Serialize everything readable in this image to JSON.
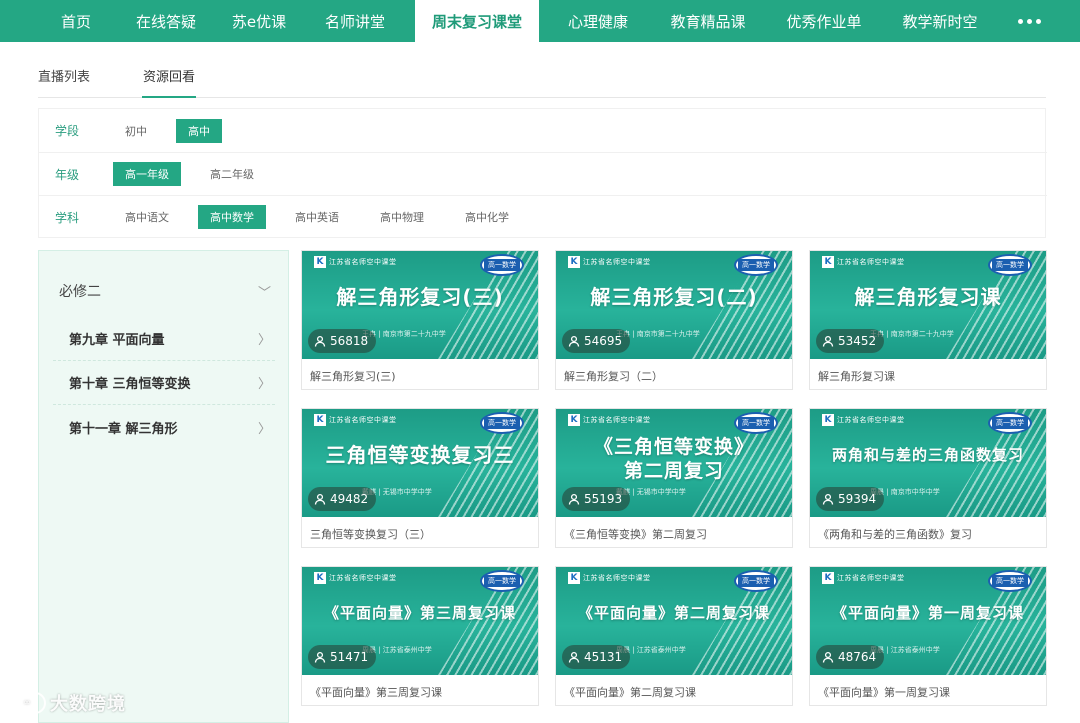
{
  "nav": {
    "items": [
      "首页",
      "在线答疑",
      "苏e优课",
      "名师讲堂",
      "周末复习课堂",
      "心理健康",
      "教育精品课",
      "优秀作业单",
      "教学新时空"
    ],
    "active_index": 4,
    "more_icon": "ellipsis-icon"
  },
  "subtabs": {
    "live_list": "直播列表",
    "replay": "资源回看",
    "active": "replay"
  },
  "filters": {
    "stage": {
      "label": "学段",
      "options": [
        "初中",
        "高中"
      ],
      "selected": "高中"
    },
    "grade": {
      "label": "年级",
      "options": [
        "高一年级",
        "高二年级"
      ],
      "selected": "高一年级"
    },
    "subject": {
      "label": "学科",
      "options": [
        "高中语文",
        "高中数学",
        "高中英语",
        "高中物理",
        "高中化学"
      ],
      "selected": "高中数学"
    }
  },
  "sidebar": {
    "header": "必修二",
    "items": [
      "第九章 平面向量",
      "第十章 三角恒等变换",
      "第十一章 解三角形"
    ]
  },
  "cards": [
    {
      "art_title": "解三角形复习(三)",
      "views": "56818",
      "caption": "解三角形复习(三)",
      "art_sub": "王冉 | 南京市第二十九中学"
    },
    {
      "art_title": "解三角形复习(二)",
      "views": "54695",
      "caption": "解三角形复习（二）",
      "art_sub": "王冉 | 南京市第二十九中学"
    },
    {
      "art_title": "解三角形复习课",
      "views": "53452",
      "caption": "解三角形复习课",
      "art_sub": "王冉 | 南京市第二十九中学"
    },
    {
      "art_title": "三角恒等变换复习三",
      "views": "49482",
      "caption": "三角恒等变换复习（三）",
      "art_sub": "戴麒 | 无锡市中学中学"
    },
    {
      "art_title": "《三角恒等变换》\n第二周复习",
      "views": "55193",
      "caption": "《三角恒等变换》第二周复习",
      "art_sub": "戴麒 | 无锡市中学中学"
    },
    {
      "art_title": "两角和与差的三角函数复习",
      "views": "59394",
      "caption": "《两角和与差的三角函数》复习",
      "art_sub": "周晨 | 南京市中华中学"
    },
    {
      "art_title": "《平面向量》第三周复习课",
      "views": "51471",
      "caption": "《平面向量》第三周复习课",
      "art_sub": "周晨 | 江苏省泰州中学"
    },
    {
      "art_title": "《平面向量》第二周复习课",
      "views": "45131",
      "caption": "《平面向量》第二周复习课",
      "art_sub": "周晨 | 江苏省泰州中学"
    },
    {
      "art_title": "《平面向量》第一周复习课",
      "views": "48764",
      "caption": "《平面向量》第一周复习课",
      "art_sub": "周晨 | 江苏省泰州中学"
    }
  ],
  "card_logo": "江苏省名师空中课堂",
  "card_badge": "高一数学",
  "watermark": "大数跨境"
}
